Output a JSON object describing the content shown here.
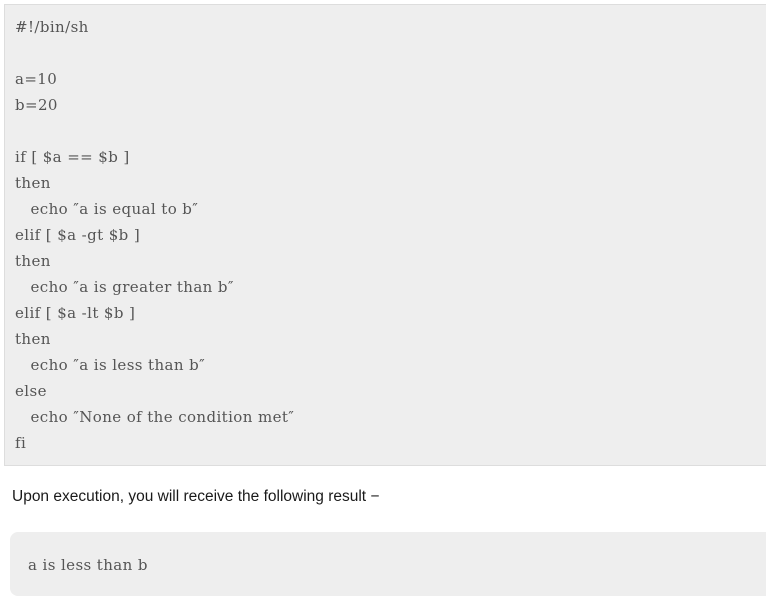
{
  "code_block": {
    "language": "sh",
    "background_color": "#eeeeee",
    "border_color": "#dddddd",
    "text_color": "#555555",
    "lines": [
      "#!/bin/sh",
      "",
      "a=10",
      "b=20",
      "",
      "if [ $a == $b ]",
      "then",
      "   echo ″a is equal to b″",
      "elif [ $a -gt $b ]",
      "then",
      "   echo ″a is greater than b″",
      "elif [ $a -lt $b ]",
      "then",
      "   echo ″a is less than b″",
      "else",
      "   echo ″None of the condition met″",
      "fi"
    ],
    "content": "#!/bin/sh\n\na=10\nb=20\n\nif [ $a == $b ]\nthen\n   echo ″a is equal to b″\nelif [ $a -gt $b ]\nthen\n   echo ″a is greater than b″\nelif [ $a -lt $b ]\nthen\n   echo ″a is less than b″\nelse\n   echo ″None of the condition met″\nfi"
  },
  "prose": {
    "text": "Upon execution, you will receive the following result −"
  },
  "output_block": {
    "background_color": "#eeeeee",
    "text_color": "#555555",
    "lines": [
      "a is less than b"
    ],
    "content": "a is less than b"
  }
}
